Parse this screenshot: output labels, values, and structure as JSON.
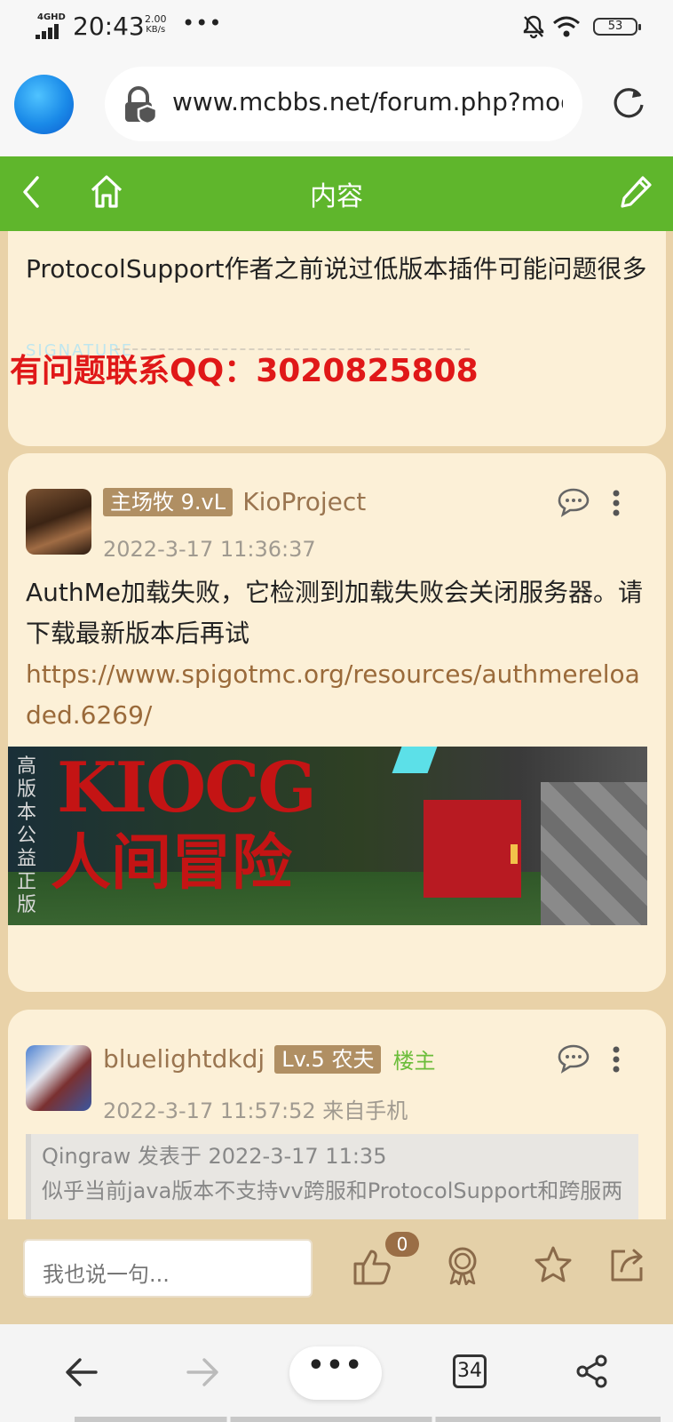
{
  "status_bar": {
    "network": "4GHD",
    "time": "20:43",
    "speed_value": "2.00",
    "speed_unit": "KB/s",
    "more": "•••",
    "battery": "53",
    "icons": [
      "mute-bell-icon",
      "wifi-icon",
      "battery-icon"
    ]
  },
  "browser": {
    "url": "www.mcbbs.net/forum.php?mod=viewthread",
    "icons": [
      "browser-logo-icon",
      "lock-icon",
      "reload-icon"
    ]
  },
  "header": {
    "title": "内容",
    "icons": [
      "back-chevron-icon",
      "home-icon",
      "edit-pencil-icon"
    ]
  },
  "posts": [
    {
      "text": "ProtocolSupport作者之前说过低版本插件可能问题很多",
      "signature_label": "SIGNATURE",
      "contact": "有问题联系QQ：3020825808"
    },
    {
      "badge": "主场牧 9.vL",
      "username": "KioProject",
      "date": "2022-3-17 11:36:37",
      "text": "AuthMe加载失败，它检测到加载失败会关闭服务器。请下载最新版本后再试",
      "link": "https://www.spigotmc.org/resources/authmereloaded.6269/",
      "banner_side": "高版本公益正版",
      "banner_title": "KIOCG",
      "banner_subtitle": "人间冒险"
    },
    {
      "username": "bluelightdkdj",
      "badge": "Lv.5 农夫",
      "owner_tag": "楼主",
      "date": "2022-3-17 11:57:52 来自手机",
      "quote_author": "Qingraw 发表于 2022-3-17 11:35",
      "quote_text": "似乎当前java版本不支持vv跨服和ProtocolSupport和跨服两"
    }
  ],
  "reply_bar": {
    "placeholder": "我也说一句...",
    "like_count": "0",
    "icons": [
      "thumbs-up-icon",
      "medal-icon",
      "star-icon",
      "share-icon"
    ]
  },
  "bottom_nav": {
    "menu": "•••",
    "tab_count": "34",
    "icons": [
      "arrow-left-icon",
      "arrow-right-icon",
      "share-nodes-icon"
    ]
  },
  "colors": {
    "header_green": "#5fb62c",
    "page_bg": "#e9d2a8",
    "card_bg": "#fcf0d7",
    "badge_brown": "#b08f63",
    "username_brown": "#9a7550",
    "link_brown": "#9a6a3a",
    "contact_red": "#e01818",
    "owner_green": "#6bbd3a"
  }
}
